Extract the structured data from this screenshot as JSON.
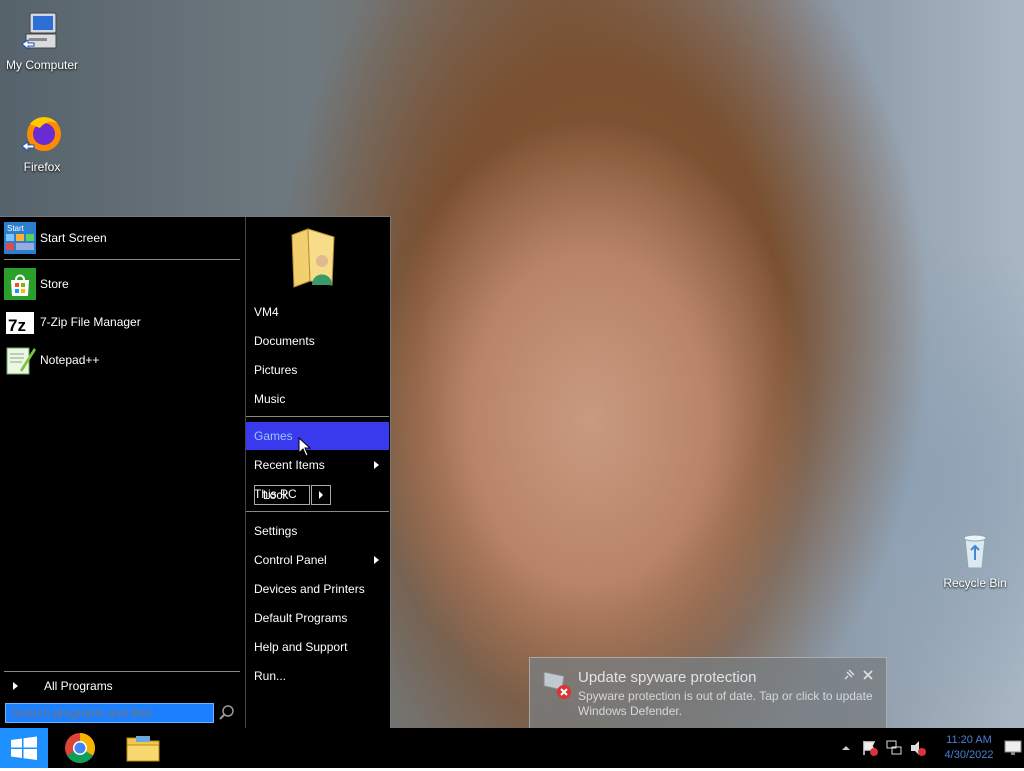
{
  "desktop": {
    "icons": [
      {
        "label": "My Computer"
      },
      {
        "label": "Firefox"
      },
      {
        "label": "Recycle Bin"
      }
    ]
  },
  "start_menu": {
    "pinned": [
      {
        "label": "Start Screen",
        "icon_tag": "Start"
      },
      {
        "label": "Store"
      },
      {
        "label": "7-Zip File Manager",
        "icon_tag": "7z"
      },
      {
        "label": "Notepad++"
      }
    ],
    "all_programs": "All Programs",
    "search_placeholder": "Search programs and files",
    "right": [
      {
        "label": "VM4"
      },
      {
        "label": "Documents"
      },
      {
        "label": "Pictures"
      },
      {
        "label": "Music"
      },
      {
        "label": "Games",
        "highlighted": true
      },
      {
        "label": "Recent Items"
      },
      {
        "label": "This PC"
      },
      {
        "label": "Settings"
      },
      {
        "label": "Control Panel"
      },
      {
        "label": "Devices and Printers"
      },
      {
        "label": "Default Programs"
      },
      {
        "label": "Help and Support"
      },
      {
        "label": "Run..."
      }
    ],
    "lock_label": "Lock"
  },
  "notification": {
    "title": "Update spyware protection",
    "body": "Spyware protection is out of date. Tap or click to update Windows Defender."
  },
  "tray": {
    "time": "11:20 AM",
    "date": "4/30/2022"
  },
  "colors": {
    "start_blue": "#1e90ff",
    "highlight": "#3939ee",
    "search_bg": "#1c7fff"
  }
}
